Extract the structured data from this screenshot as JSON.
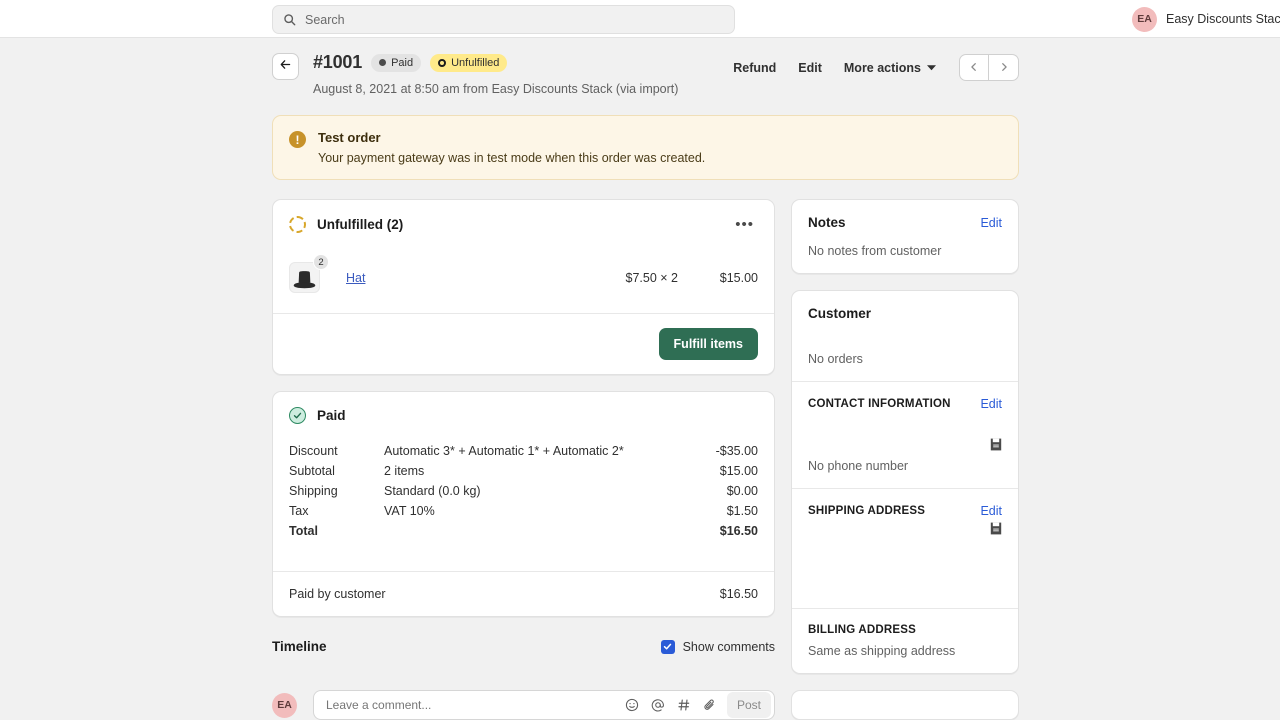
{
  "topbar": {
    "search_placeholder": "Search",
    "search_value": "",
    "search_icon": "search-icon",
    "user_initials": "EA",
    "user_name": "Easy Discounts Stack A"
  },
  "order": {
    "back_icon": "arrow-left-icon",
    "number": "#1001",
    "badges": [
      {
        "label": "Paid",
        "style": "gray",
        "icon": "filled-dot-icon"
      },
      {
        "label": "Unfulfilled",
        "style": "yellow",
        "icon": "ring-icon"
      }
    ],
    "subtitle": "August 8, 2021 at 8:50 am from Easy Discounts Stack (via import)",
    "actions": {
      "refund": "Refund",
      "edit": "Edit",
      "more": "More actions",
      "more_icon": "chevron-down-icon",
      "prev_icon": "chevron-left-icon",
      "next_icon": "chevron-right-icon"
    }
  },
  "banner": {
    "icon": "exclamation-icon",
    "glyph": "!",
    "title": "Test order",
    "text": "Your payment gateway was in test mode when this order was created."
  },
  "fulfillment": {
    "icon": "dashed-ring-icon",
    "title": "Unfulfilled (2)",
    "overflow_icon": "ellipsis-icon",
    "overflow_glyph": "•••",
    "items": [
      {
        "thumb_icon": "hat-product-image",
        "qty_badge": "2",
        "name": "Hat",
        "unit_price": "$7.50 × 2",
        "line_total": "$15.00"
      }
    ],
    "fulfill_button": "Fulfill items"
  },
  "payment": {
    "icon": "check-circle-icon",
    "title": "Paid",
    "rows": [
      {
        "label": "Discount",
        "detail": "Automatic 3* + Automatic 1* + Automatic 2*",
        "amount": "-$35.00",
        "strong": false
      },
      {
        "label": "Subtotal",
        "detail": "2 items",
        "amount": "$15.00",
        "strong": false
      },
      {
        "label": "Shipping",
        "detail": "Standard (0.0 kg)",
        "amount": "$0.00",
        "strong": false
      },
      {
        "label": "Tax",
        "detail": "VAT 10%",
        "amount": "$1.50",
        "strong": false
      },
      {
        "label": "Total",
        "detail": "",
        "amount": "$16.50",
        "strong": true
      }
    ],
    "paid_label": "Paid by customer",
    "paid_amount": "$16.50"
  },
  "timeline": {
    "title": "Timeline",
    "show_comments_label": "Show comments",
    "show_comments_checked": true,
    "check_icon": "checkmark-icon",
    "avatar_initials": "EA",
    "comment_placeholder": "Leave a comment...",
    "comment_value": "",
    "icons": {
      "emoji": "emoji-icon",
      "mention": "mention-icon",
      "hashtag": "hashtag-icon",
      "attachment": "paperclip-icon"
    },
    "post_button": "Post"
  },
  "sidebar": {
    "notes": {
      "title": "Notes",
      "edit": "Edit",
      "empty_text": "No notes from customer"
    },
    "customer": {
      "title": "Customer",
      "name": "",
      "orders_text": "No orders"
    },
    "contact": {
      "title": "CONTACT INFORMATION",
      "edit": "Edit",
      "email": "",
      "copy_icon": "copy-icon",
      "phone_text": "No phone number"
    },
    "shipping": {
      "title": "SHIPPING ADDRESS",
      "edit": "Edit",
      "copy_icon": "copy-icon",
      "address": ""
    },
    "billing": {
      "title": "BILLING ADDRESS",
      "text": "Same as shipping address"
    }
  }
}
